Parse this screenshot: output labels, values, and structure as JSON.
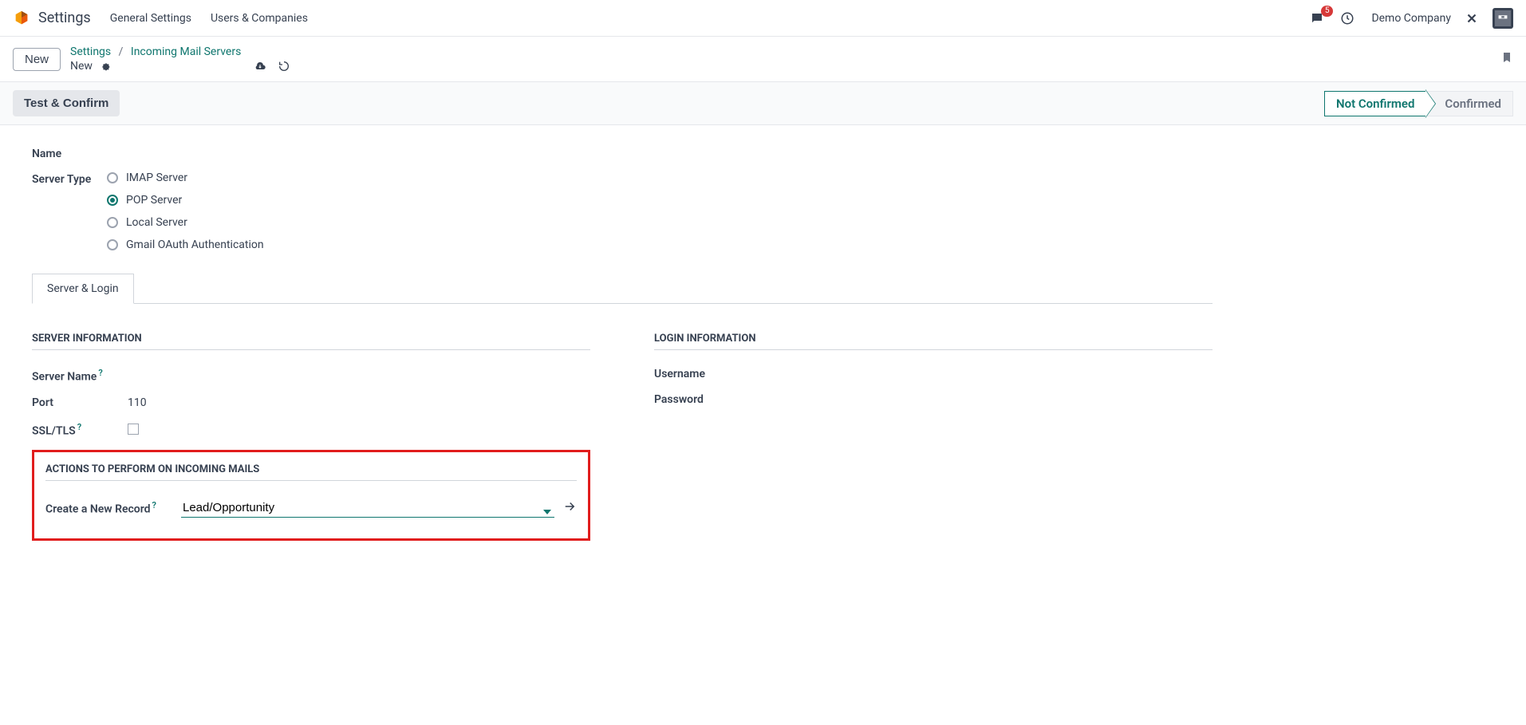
{
  "nav": {
    "app_title": "Settings",
    "menu": [
      "General Settings",
      "Users & Companies"
    ],
    "msg_badge": "5",
    "company": "Demo Company"
  },
  "crumb": {
    "new_btn": "New",
    "path": [
      "Settings",
      "Incoming Mail Servers"
    ],
    "current": "New"
  },
  "actions": {
    "test_confirm": "Test & Confirm",
    "status": [
      "Not Confirmed",
      "Confirmed"
    ],
    "active_status_index": 0
  },
  "form": {
    "name_label": "Name",
    "server_type_label": "Server Type",
    "server_type_options": [
      "IMAP Server",
      "POP Server",
      "Local Server",
      "Gmail OAuth Authentication"
    ],
    "server_type_selected": 1,
    "tab": "Server & Login",
    "server_info_title": "SERVER INFORMATION",
    "login_info_title": "LOGIN INFORMATION",
    "server_name_label": "Server Name",
    "port_label": "Port",
    "port_value": "110",
    "ssl_label": "SSL/TLS",
    "username_label": "Username",
    "password_label": "Password",
    "actions_title": "ACTIONS TO PERFORM ON INCOMING MAILS",
    "create_record_label": "Create a New Record",
    "create_record_value": "Lead/Opportunity"
  }
}
